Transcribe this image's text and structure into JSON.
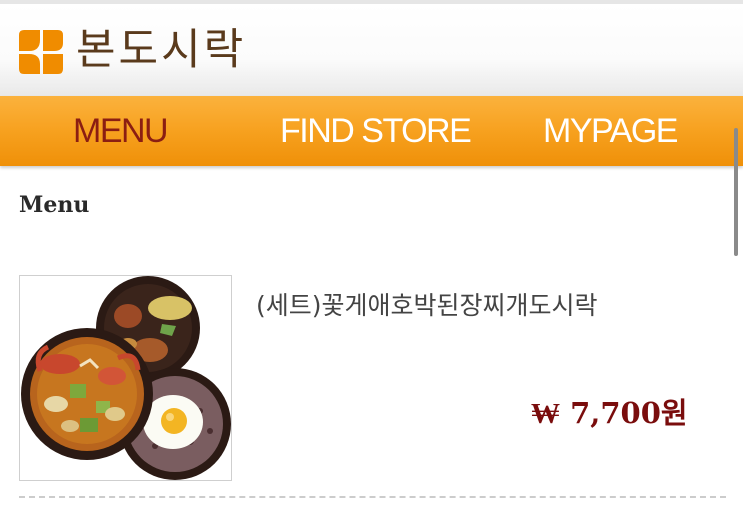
{
  "brand": {
    "name": "본도시락",
    "icon": "four-leaf-logo-icon",
    "colors": {
      "leaf": "#f08c00",
      "text": "#5a3a1c"
    }
  },
  "nav": {
    "items": [
      {
        "label": "MENU",
        "active": true
      },
      {
        "label": "FIND STORE",
        "active": false
      },
      {
        "label": "MYPAGE",
        "active": false
      }
    ],
    "colors": {
      "bar": "#f7a11f",
      "active_text": "#8b1e12",
      "text": "#ffffff"
    }
  },
  "main": {
    "section_title": "Menu",
    "products": [
      {
        "name": "(세트)꽃게애호박된장찌개도시락",
        "price": "₩ 7,700원",
        "image": "lunchbox-set-photo"
      }
    ]
  }
}
